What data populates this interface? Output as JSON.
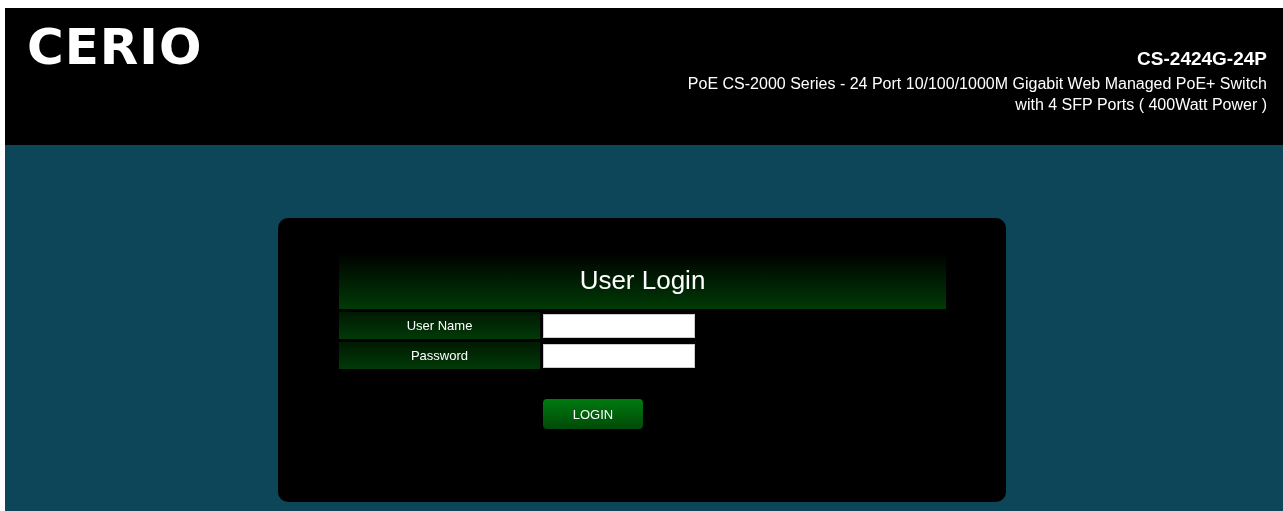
{
  "header": {
    "logo": "CERIO",
    "model": "CS-2424G-24P",
    "description_lines": [
      "PoE CS-2000 Series - 24 Port 10/100/1000M Gigabit Web Managed PoE+ Switch",
      "with 4 SFP Ports ( 400Watt Power )"
    ]
  },
  "login": {
    "title": "User Login",
    "fields": [
      {
        "label": "User Name"
      },
      {
        "label": "Password"
      }
    ],
    "button": "LOGIN"
  }
}
